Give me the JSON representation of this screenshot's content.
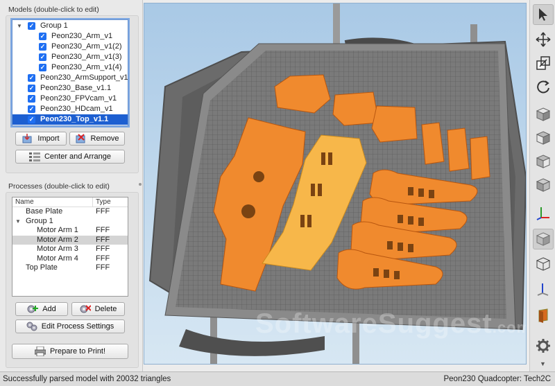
{
  "models": {
    "label": "Models (double-click to edit)",
    "items": [
      {
        "name": "Group 1",
        "level": 0,
        "expandable": true,
        "checked": true,
        "selected": false
      },
      {
        "name": "Peon230_Arm_v1",
        "level": 1,
        "expandable": false,
        "checked": true,
        "selected": false
      },
      {
        "name": "Peon230_Arm_v1(2)",
        "level": 1,
        "expandable": false,
        "checked": true,
        "selected": false
      },
      {
        "name": "Peon230_Arm_v1(3)",
        "level": 1,
        "expandable": false,
        "checked": true,
        "selected": false
      },
      {
        "name": "Peon230_Arm_v1(4)",
        "level": 1,
        "expandable": false,
        "checked": true,
        "selected": false
      },
      {
        "name": "Peon230_ArmSupport_v1",
        "level": 0,
        "expandable": false,
        "checked": true,
        "selected": false
      },
      {
        "name": "Peon230_Base_v1.1",
        "level": 0,
        "expandable": false,
        "checked": true,
        "selected": false
      },
      {
        "name": "Peon230_FPVcam_v1",
        "level": 0,
        "expandable": false,
        "checked": true,
        "selected": false
      },
      {
        "name": "Peon230_HDcam_v1",
        "level": 0,
        "expandable": false,
        "checked": true,
        "selected": false
      },
      {
        "name": "Peon230_Top_v1.1",
        "level": 0,
        "expandable": false,
        "checked": true,
        "selected": true
      }
    ],
    "import_label": "Import",
    "remove_label": "Remove",
    "center_arrange_label": "Center and Arrange"
  },
  "processes": {
    "label": "Processes (double-click to edit)",
    "col_name": "Name",
    "col_type": "Type",
    "rows": [
      {
        "name": "Base Plate",
        "type": "FFF",
        "level": 0,
        "expandable": false,
        "selected": false
      },
      {
        "name": "Group 1",
        "type": "",
        "level": 0,
        "expandable": true,
        "selected": false
      },
      {
        "name": "Motor Arm 1",
        "type": "FFF",
        "level": 1,
        "expandable": false,
        "selected": false
      },
      {
        "name": "Motor Arm 2",
        "type": "FFF",
        "level": 1,
        "expandable": false,
        "selected": true
      },
      {
        "name": "Motor Arm 3",
        "type": "FFF",
        "level": 1,
        "expandable": false,
        "selected": false
      },
      {
        "name": "Motor Arm 4",
        "type": "FFF",
        "level": 1,
        "expandable": false,
        "selected": false
      },
      {
        "name": "Top Plate",
        "type": "FFF",
        "level": 0,
        "expandable": false,
        "selected": false
      }
    ],
    "add_label": "Add",
    "delete_label": "Delete",
    "edit_label": "Edit Process Settings",
    "prepare_label": "Prepare to Print!"
  },
  "viewport": {
    "watermark": "SoftwareSuggest",
    "watermark_suffix": ".com"
  },
  "toolbar": {
    "icons": [
      "cursor-icon",
      "move-icon",
      "scale-icon",
      "rotate-icon",
      "view-top-cube-icon",
      "view-front-cube-icon",
      "view-left-cube-icon",
      "view-right-cube-icon",
      "axes-icon",
      "solid-cube-icon",
      "wireframe-cube-icon",
      "axis-view-icon",
      "cross-section-icon",
      "settings-gear-icon",
      "scroll-down-icon"
    ]
  },
  "status": {
    "message": "Successfully parsed model with 20032 triangles",
    "project": "Peon230 Quadcopter: Tech2C"
  },
  "colors": {
    "selection": "#1d5fd1",
    "part_orange": "#f08a2e",
    "part_light": "#f7b74a",
    "bed_grid": "#6b6b6b",
    "sky_top": "#a9c9e6"
  }
}
